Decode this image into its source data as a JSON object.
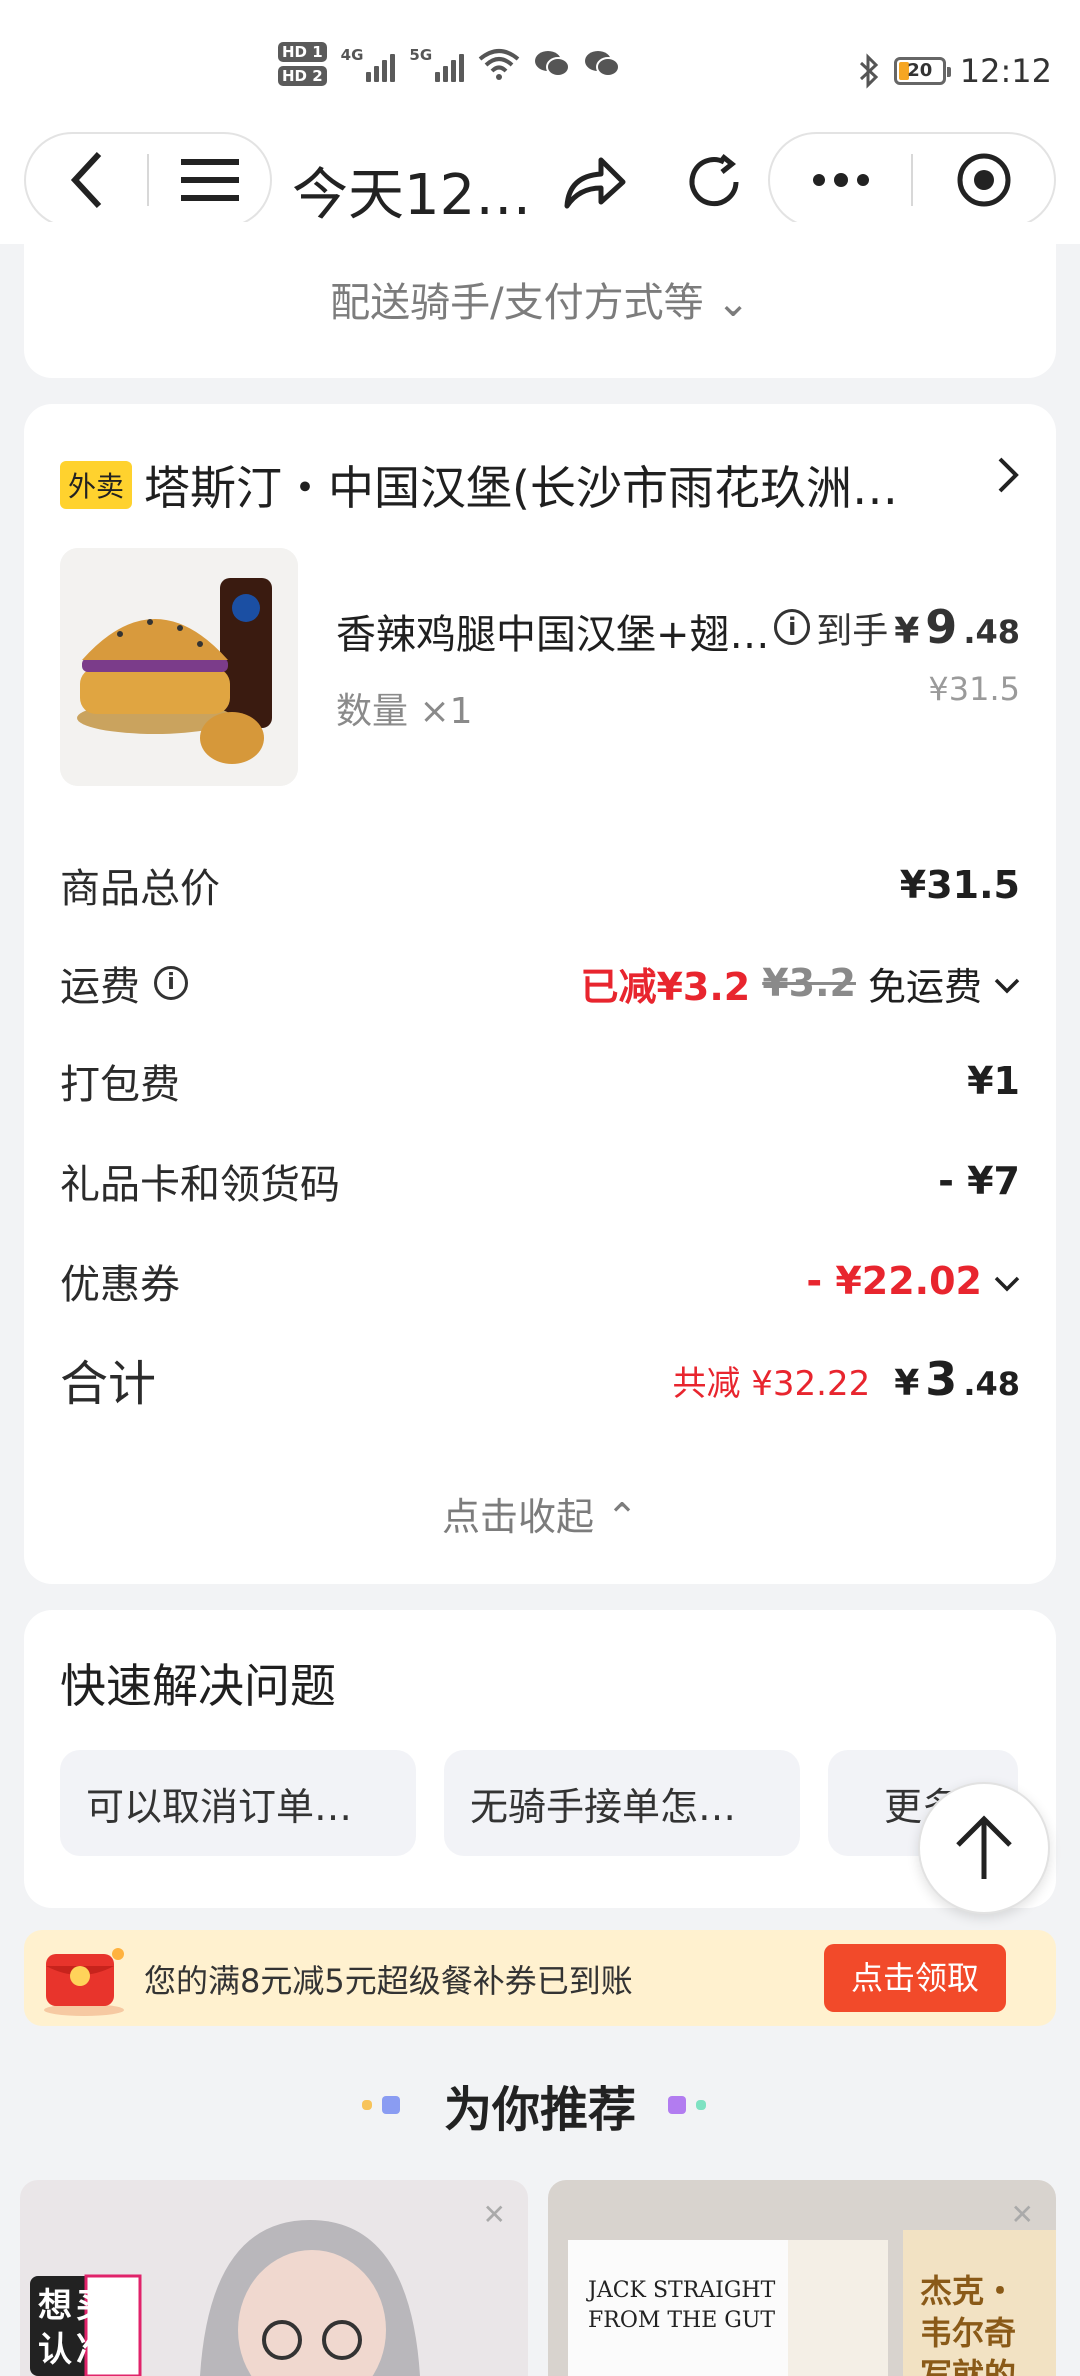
{
  "status_bar": {
    "hd1": "HD 1",
    "hd2": "HD 2",
    "net1": "4G",
    "net2": "5G",
    "time": "12:12",
    "battery": "20"
  },
  "nav": {
    "title": "今天12…"
  },
  "delivery_section": {
    "expand_label": "配送骑手/支付方式等 ⌄"
  },
  "order": {
    "tag": "外卖",
    "store_name": "塔斯汀・中国汉堡(长沙市雨花玖洲…",
    "product": {
      "title": "香辣鸡腿中国汉堡+翅…",
      "qty": "数量 ×1",
      "price_prefix": "到手",
      "price_yen": "¥",
      "price_int": "9",
      "price_dec": ".48",
      "orig_price": "¥31.5"
    },
    "rows": {
      "goods_total_label": "商品总价",
      "goods_total_value": "¥31.5",
      "delivery_label": "运费",
      "delivery_reduced": "已减¥3.2",
      "delivery_strike": "¥3.2",
      "delivery_free": "免运费",
      "packing_label": "打包费",
      "packing_value": "¥1",
      "giftcard_label": "礼品卡和领货码",
      "giftcard_value": "- ¥7",
      "coupon_label": "优惠券",
      "coupon_value": "- ¥22.02",
      "total_label": "合计",
      "total_saved": "共减 ¥32.22",
      "total_yen": "¥",
      "total_int": "3",
      "total_dec": ".48"
    },
    "collapse_label": "点击收起 ⌃"
  },
  "quick_help": {
    "title": "快速解决问题",
    "chips": [
      "可以取消订单…",
      "无骑手接单怎…",
      "更多"
    ]
  },
  "banner": {
    "text": "您的满8元减5元超级餐补券已到账",
    "button": "点击领取"
  },
  "recommend": {
    "title": "为你推荐",
    "tile1_text": "想买 认准",
    "tile2_text": "JACK STRAIGHT FROM THE GUT",
    "tile2_side": "杰克・韦尔奇 写就的"
  },
  "colors": {
    "accent_red": "#e8252e",
    "tag_yellow": "#ffd22e",
    "banner_btn": "#f24a2a"
  }
}
